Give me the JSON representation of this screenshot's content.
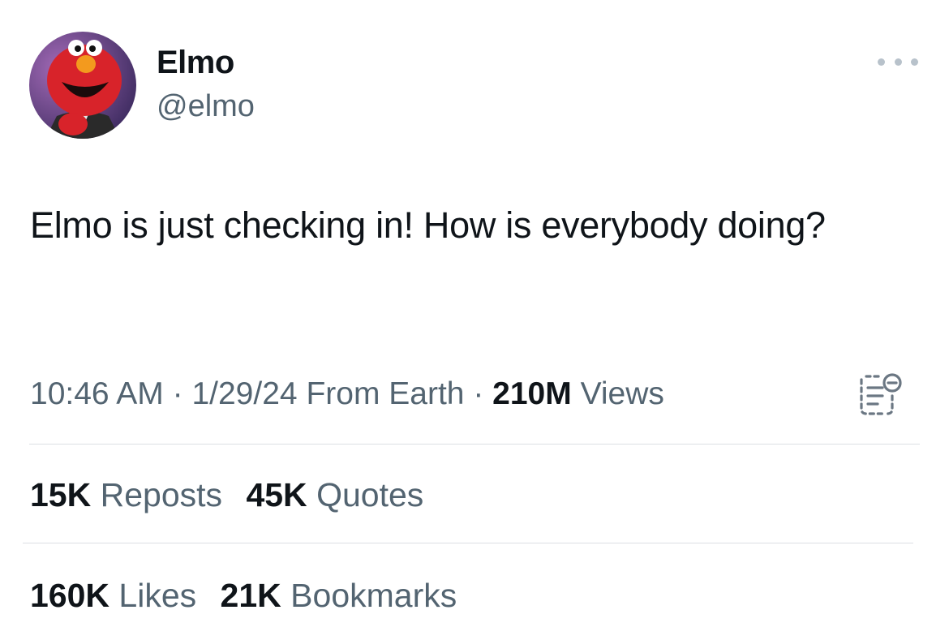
{
  "author": {
    "display_name": "Elmo",
    "handle": "@elmo"
  },
  "more_icon": "more-horizontal-icon",
  "tweet": {
    "text": "Elmo is just checking in! How is everybody doing?",
    "time": "10:46 AM",
    "separator": "·",
    "date": "1/29/24",
    "location": "From Earth",
    "views_count": "210M",
    "views_label": "Views"
  },
  "notes_icon": "community-notes-icon",
  "stats": {
    "reposts": {
      "count": "15K",
      "label": "Reposts"
    },
    "quotes": {
      "count": "45K",
      "label": "Quotes"
    },
    "likes": {
      "count": "160K",
      "label": "Likes"
    },
    "bookmarks": {
      "count": "21K",
      "label": "Bookmarks"
    }
  },
  "colors": {
    "text": "#0f1419",
    "secondary": "#536471",
    "divider": "#dcdfe3"
  }
}
